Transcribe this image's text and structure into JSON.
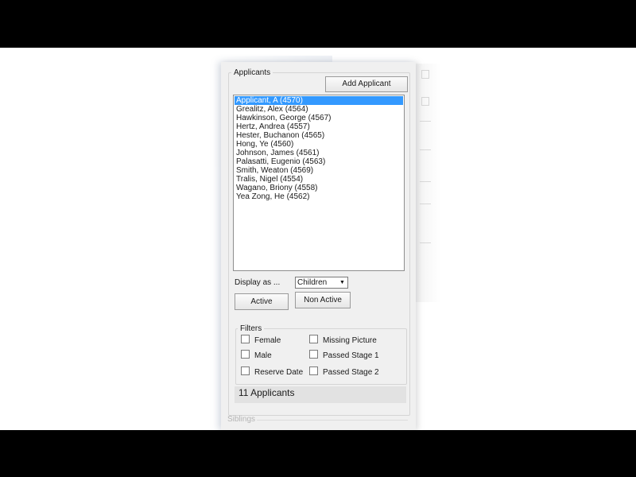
{
  "applicants": {
    "legend": "Applicants",
    "add_button": "Add Applicant",
    "items": [
      "Applicant, A (4570)",
      "Grealitz, Alex (4564)",
      "Hawkinson, George (4567)",
      "Hertz, Andrea (4557)",
      "Hester, Buchanon (4565)",
      "Hong, Ye (4560)",
      "Johnson, James (4561)",
      "Palasatti, Eugenio (4563)",
      "Smith, Weaton (4569)",
      "Tralis, Nigel (4554)",
      "Wagano, Briony (4558)",
      "Yea Zong, He (4562)"
    ],
    "selected_index": 0,
    "display_as_label": "Display as ...",
    "display_as_value": "Children",
    "active_button": "Active",
    "non_active_button": "Non Active",
    "filters": {
      "legend": "Filters",
      "female": "Female",
      "male": "Male",
      "reserve_date": "Reserve Date",
      "missing_picture": "Missing Picture",
      "passed_stage_1": "Passed Stage 1",
      "passed_stage_2": "Passed Stage 2"
    },
    "count_text": "11 Applicants"
  },
  "siblings": {
    "legend": "Siblings"
  },
  "colors": {
    "selection": "#3399ff",
    "panel_bg": "#f0f0f0",
    "letterbox": "#000000"
  },
  "icons": {
    "dropdown": "chevron-down-icon"
  }
}
